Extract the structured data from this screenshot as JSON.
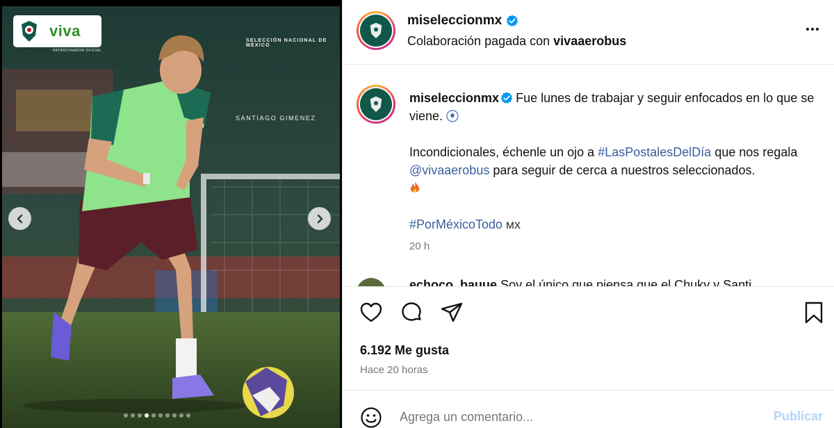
{
  "media": {
    "sponsor_brand": "viva",
    "sponsor_caption": "PATROCINADOR OFICIAL",
    "overlay_title": "SELECCIÓN NACIONAL DE MÉXICO",
    "player_name": "SANTIAGO GIMENEZ",
    "carousel": {
      "total": 10,
      "active_index": 3
    },
    "colors": {
      "jersey": "#8fe38a",
      "shorts": "#5a1f28",
      "grass": "#3f5a2b"
    }
  },
  "header": {
    "username": "miseleccionmx",
    "collab_prefix": "Colaboración pagada con",
    "collab_partner": "vivaaerobus",
    "verified": true
  },
  "caption": {
    "username": "miseleccionmx",
    "line1": "Fue lunes de trabajar y seguir enfocados en lo que se viene.",
    "line2_a": "Incondicionales, échenle un ojo a",
    "hashtag1": "#LasPostalesDelDía",
    "line2_b": "que nos regala",
    "mention": "@vivaaerobus",
    "line2_c": "para seguir de cerca a nuestros seleccionados.",
    "hashtag2": "#PorMéxicoTodo",
    "flag_text": "MX",
    "time": "20 h"
  },
  "comment_preview": {
    "username": "echoco_bauue",
    "text": "Soy el único que piensa que el Chuky y Santi"
  },
  "actions": {
    "likes": "6.192 Me gusta",
    "time_ago": "Hace 20 horas"
  },
  "comment_bar": {
    "placeholder": "Agrega un comentario...",
    "publish": "Publicar"
  },
  "colors": {
    "link": "#3a5f9e",
    "verified": "#0095f6",
    "publish_disabled": "#b3d4f7"
  }
}
